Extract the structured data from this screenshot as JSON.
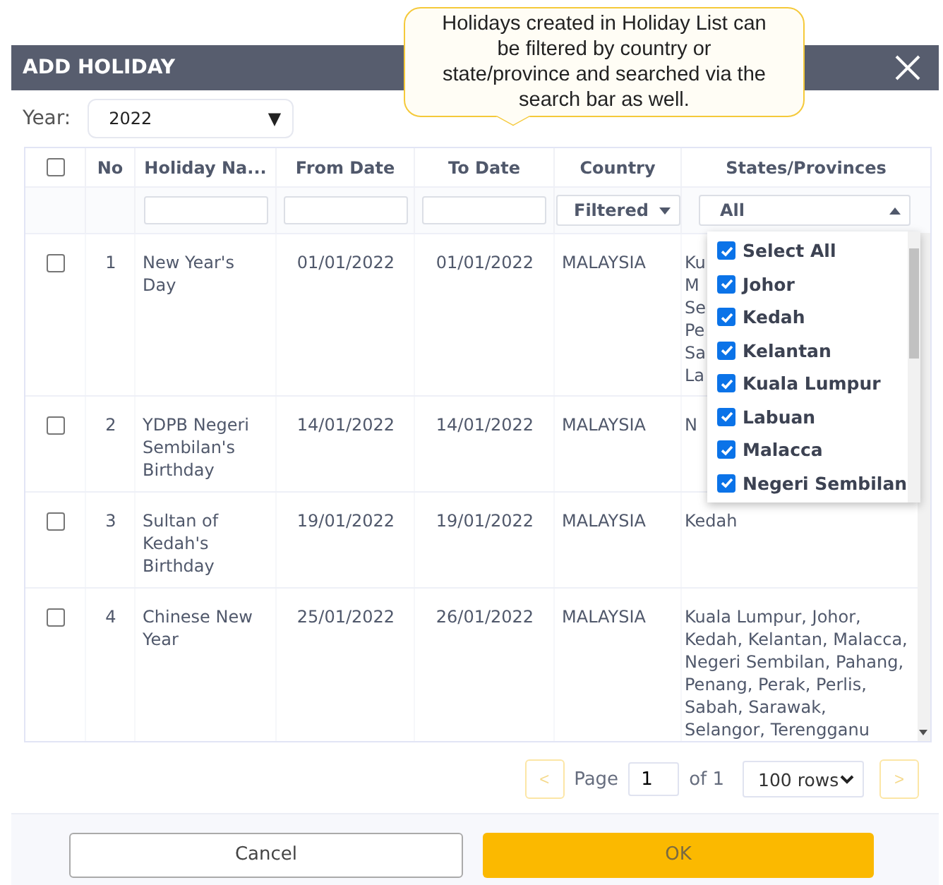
{
  "dialog": {
    "title": "ADD HOLIDAY"
  },
  "tooltip": {
    "text": "Holidays created in Holiday List can be filtered by country or state/province and searched via the search bar as well."
  },
  "year": {
    "label": "Year:",
    "value": "2022",
    "arrow": "▼"
  },
  "table": {
    "header_checkbox": {
      "checked": false
    },
    "columns": [
      "No",
      "Holiday Na...",
      "From Date",
      "To Date",
      "Country",
      "States/Provinces"
    ],
    "filters": {
      "country": {
        "value": "Filtered"
      },
      "states": {
        "value": "All",
        "expanded": true
      }
    },
    "rows": [
      {
        "checked": false,
        "no": "1",
        "name": "New Year's Day",
        "from": "01/01/2022",
        "to": "01/01/2022",
        "country": "MALAYSIA",
        "states": [
          "Ku",
          "M",
          "Se",
          "Pe",
          "Sa",
          "La"
        ]
      },
      {
        "checked": false,
        "no": "2",
        "name": "YDPB Negeri Sembilan's Birthday",
        "from": "14/01/2022",
        "to": "14/01/2022",
        "country": "MALAYSIA",
        "states": [
          "N"
        ]
      },
      {
        "checked": false,
        "no": "3",
        "name": "Sultan of Kedah's Birthday",
        "from": "19/01/2022",
        "to": "19/01/2022",
        "country": "MALAYSIA",
        "states": [
          "Kedah"
        ]
      },
      {
        "checked": false,
        "no": "4",
        "name": "Chinese New Year",
        "from": "25/01/2022",
        "to": "26/01/2022",
        "country": "MALAYSIA",
        "states": [
          "Kuala Lumpur, Johor, Kedah, Kelantan, Malacca, Negeri Sembilan, Pahang, Penang, Perak, Perlis, Sabah, Sarawak, Selangor, Terengganu"
        ]
      }
    ]
  },
  "states_dropdown": {
    "options": [
      {
        "label": "Select All",
        "checked": true
      },
      {
        "label": "Johor",
        "checked": true
      },
      {
        "label": "Kedah",
        "checked": true
      },
      {
        "label": "Kelantan",
        "checked": true
      },
      {
        "label": "Kuala Lumpur",
        "checked": true
      },
      {
        "label": "Labuan",
        "checked": true
      },
      {
        "label": "Malacca",
        "checked": true
      },
      {
        "label": "Negeri Sembilan",
        "checked": true
      }
    ]
  },
  "pagination": {
    "prev": {
      "label": "<",
      "disabled": true
    },
    "page_label": "Page",
    "page": "1",
    "of": "of 1",
    "rows": "100 rows",
    "next": {
      "label": ">",
      "disabled": true
    }
  },
  "buttons": [
    {
      "kind": "secondary",
      "label": "Cancel"
    },
    {
      "kind": "primary",
      "label": "OK"
    }
  ]
}
